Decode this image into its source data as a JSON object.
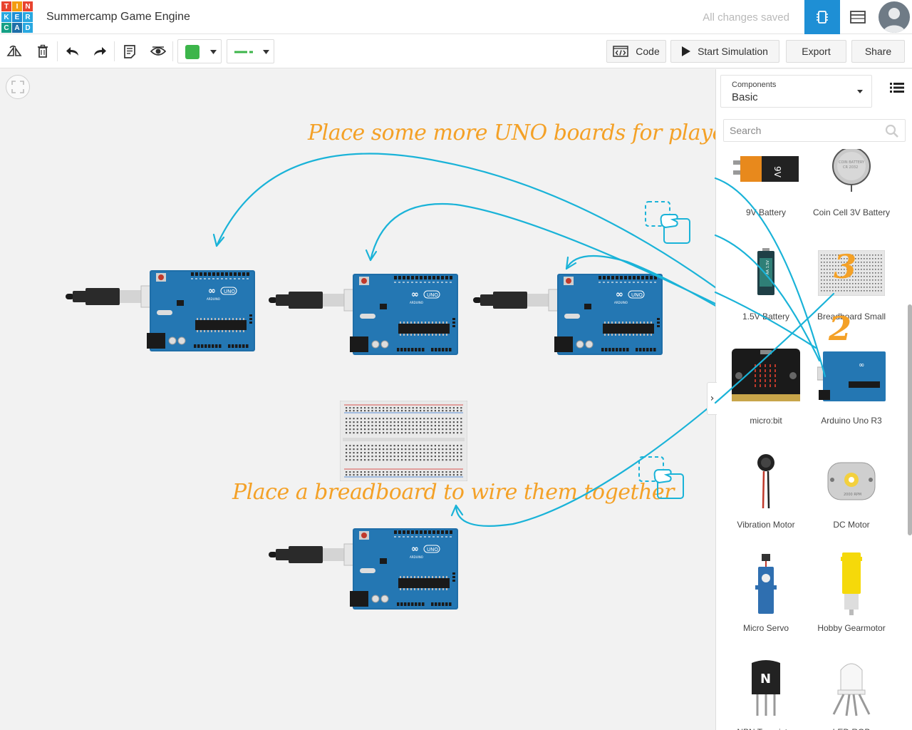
{
  "app": {
    "logo_letters": [
      "T",
      "I",
      "N",
      "K",
      "E",
      "R",
      "C",
      "A",
      "D"
    ],
    "logo_colors": [
      "#e8432f",
      "#f39c12",
      "#e8432f",
      "#29a8e0",
      "#1e8fd5",
      "#29a8e0",
      "#16a085",
      "#1e6fa8",
      "#29a8e0"
    ],
    "title": "Summercamp Game Engine",
    "save_status": "All changes saved",
    "view_buttons": [
      {
        "icon": "circuit-view-icon",
        "active": true
      },
      {
        "icon": "component-list-view-icon",
        "active": false
      }
    ],
    "avatar_icon": "user-avatar-icon"
  },
  "toolbar": {
    "tools": [
      "rotate-icon",
      "delete-icon",
      "undo-icon",
      "redo-icon",
      "notes-icon",
      "visibility-icon"
    ],
    "fill_color": "#3cb54a",
    "wire_color": "#3cb54a",
    "code_label": "Code",
    "start_simulation_label": "Start Simulation",
    "export_label": "Export",
    "share_label": "Share"
  },
  "canvas": {
    "fit_view_icon": "fit-view-icon",
    "annotations": {
      "top": "Place some more UNO boards for players",
      "bottom": "Place a breadboard to wire them together",
      "num2": "2",
      "num3": "3"
    },
    "drag_icons": [
      "drag-hand-icon",
      "drag-hand-icon"
    ],
    "arrow_color": "#1ab3d8"
  },
  "panel": {
    "components_label": "Components",
    "components_value": "Basic",
    "list_view_icon": "list-view-icon",
    "search_placeholder": "Search",
    "search_icon": "search-icon",
    "collapse_icon": "chevron-right-icon",
    "items": [
      {
        "label": "9V Battery",
        "icon": "9v-battery-icon"
      },
      {
        "label": "Coin Cell 3V Battery",
        "icon": "coin-cell-icon"
      },
      {
        "label": "1.5V Battery",
        "icon": "aa-battery-icon"
      },
      {
        "label": "Breadboard Small",
        "icon": "breadboard-icon"
      },
      {
        "label": "micro:bit",
        "icon": "microbit-icon"
      },
      {
        "label": "Arduino Uno R3",
        "icon": "arduino-icon"
      },
      {
        "label": "Vibration Motor",
        "icon": "vibration-motor-icon"
      },
      {
        "label": "DC Motor",
        "icon": "dc-motor-icon"
      },
      {
        "label": "Micro Servo",
        "icon": "micro-servo-icon"
      },
      {
        "label": "Hobby Gearmotor",
        "icon": "gearmotor-icon"
      },
      {
        "label": "NPN Transistor",
        "icon": "transistor-icon"
      },
      {
        "label": "LED RGB",
        "icon": "rgb-led-icon"
      }
    ]
  }
}
